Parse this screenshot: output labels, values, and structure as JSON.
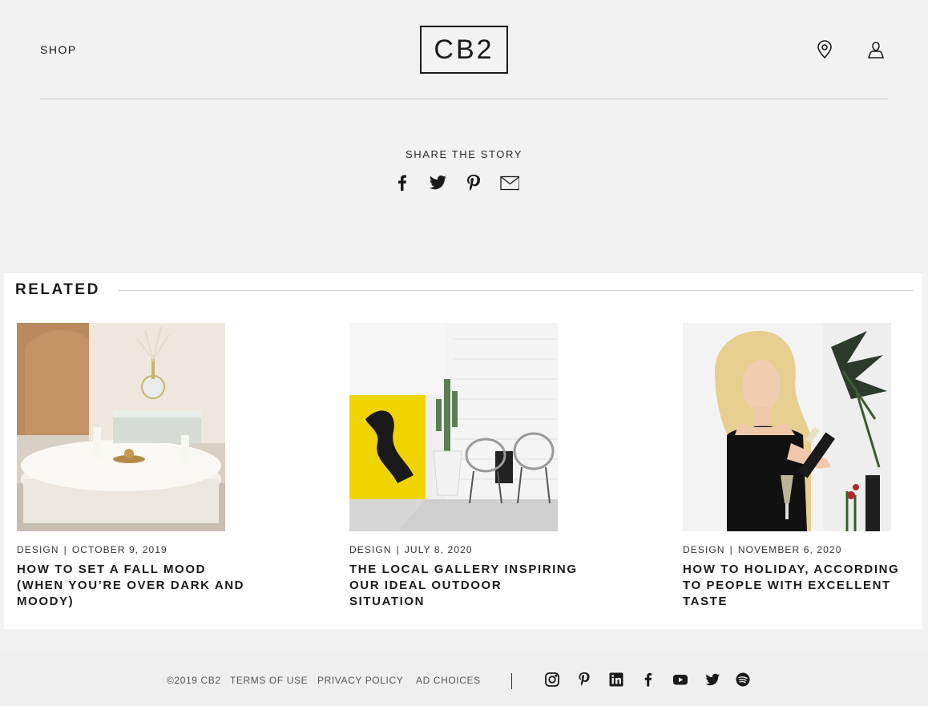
{
  "header": {
    "shop_label": "SHOP",
    "logo_text": "CB2",
    "icons": [
      "location-pin-icon",
      "account-icon"
    ]
  },
  "share": {
    "title": "SHARE THE STORY",
    "icons": [
      "facebook-icon",
      "twitter-icon",
      "pinterest-icon",
      "email-icon"
    ]
  },
  "related": {
    "title": "RELATED",
    "cards": [
      {
        "category": "DESIGN",
        "date": "OCTOBER 9, 2019",
        "title": "HOW TO SET A FALL MOOD (WHEN YOU’RE OVER DARK AND MOODY)"
      },
      {
        "category": "DESIGN",
        "date": "JULY 8, 2020",
        "title": "THE LOCAL GALLERY INSPIRING OUR IDEAL OUTDOOR SITUATION"
      },
      {
        "category": "DESIGN",
        "date": "NOVEMBER 6, 2020",
        "title": "HOW TO HOLIDAY, ACCORDING TO PEOPLE WITH EXCELLENT TASTE"
      }
    ],
    "separator": "|"
  },
  "footer": {
    "copyright": "©2019 CB2",
    "terms": "TERMS OF USE",
    "privacy": "PRIVACY POLICY",
    "ad_choices": "AD CHOICES",
    "social_icons": [
      "instagram-icon",
      "pinterest-icon",
      "linkedin-icon",
      "facebook-icon",
      "youtube-icon",
      "twitter-icon",
      "spotify-icon"
    ]
  },
  "colors": {
    "page_bg": "#f2f2f2",
    "panel_bg": "#ffffff",
    "text": "#1a1a1a",
    "accent_yellow": "#f0d400"
  }
}
